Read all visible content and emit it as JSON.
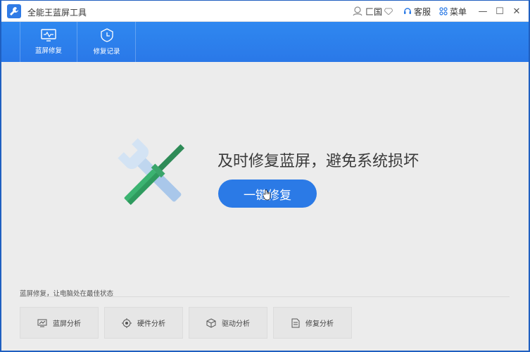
{
  "titlebar": {
    "app_title": "全能王蓝屏工具",
    "user_label": "匚国",
    "service_label": "客服",
    "menu_label": "菜单",
    "minimize": "—",
    "maximize": "☐",
    "close": "✕"
  },
  "toolbar": {
    "tabs": [
      {
        "label": "蓝屏修复",
        "icon": "monitor-icon"
      },
      {
        "label": "修复记录",
        "icon": "clock-record-icon"
      }
    ]
  },
  "main": {
    "slogan": "及时修复蓝屏，避免系统损坏",
    "repair_button": "一键修复"
  },
  "bottom": {
    "status_text": "蓝屏修复，让电脑处在最佳状态",
    "features": [
      {
        "label": "蓝屏分析",
        "icon": "chart-screen-icon"
      },
      {
        "label": "硬件分析",
        "icon": "hardware-icon"
      },
      {
        "label": "驱动分析",
        "icon": "driver-cube-icon"
      },
      {
        "label": "修复分析",
        "icon": "document-icon"
      }
    ]
  },
  "colors": {
    "accent": "#2b7ae6",
    "toolbar": "#2f88f0",
    "background": "#ececec"
  }
}
